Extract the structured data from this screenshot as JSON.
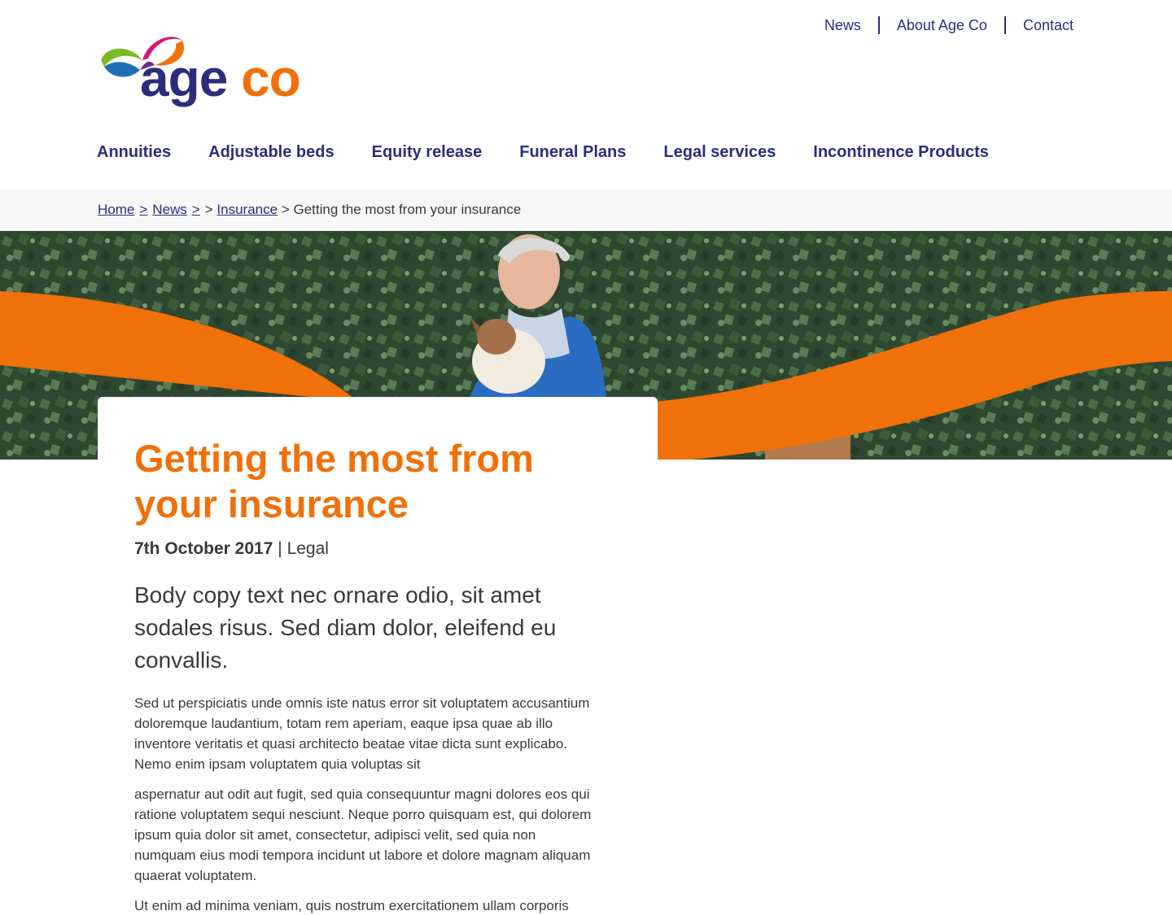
{
  "utility_nav": {
    "items": [
      {
        "label": "News"
      },
      {
        "label": "About Age Co"
      },
      {
        "label": "Contact"
      }
    ]
  },
  "logo": {
    "word1": "age",
    "word2": "co",
    "colors": {
      "navy": "#2b2d7c",
      "orange": "#f07009",
      "green": "#7ab929",
      "magenta": "#d6157a",
      "blue": "#1f6fb6"
    }
  },
  "main_nav": {
    "items": [
      {
        "label": "Annuities"
      },
      {
        "label": "Adjustable beds"
      },
      {
        "label": "Equity release"
      },
      {
        "label": "Funeral Plans"
      },
      {
        "label": "Legal services"
      },
      {
        "label": "Incontinence Products"
      }
    ]
  },
  "breadcrumb": {
    "home": "Home",
    "news": "News",
    "insurance": "Insurance",
    "current": "Getting the most from your insurance",
    "separator": ">"
  },
  "hero": {
    "image_icon": "hero-photo-woman-with-dog-icon"
  },
  "article": {
    "title": "Getting the most from your insurance",
    "date": "7th October 2017",
    "meta_separator": "|",
    "category": "Legal",
    "lead": "Body copy text nec ornare odio, sit amet sodales risus. Sed diam dolor, eleifend eu convallis.",
    "paragraphs": [
      "Sed ut perspiciatis unde omnis iste natus error sit voluptatem accusantium doloremque laudantium, totam rem aperiam, eaque ipsa quae ab illo inventore veritatis et quasi architecto beatae vitae dicta sunt explicabo. Nemo enim ipsam voluptatem quia voluptas sit",
      "aspernatur aut odit aut fugit, sed quia consequuntur magni dolores eos qui ratione voluptatem sequi nesciunt. Neque porro quisquam est, qui dolorem ipsum quia dolor sit amet, consectetur, adipisci velit, sed quia non numquam eius modi tempora incidunt ut labore et dolore magnam aliquam quaerat voluptatem.",
      "Ut enim ad minima veniam, quis nostrum exercitationem ullam corporis"
    ]
  },
  "colors": {
    "brand_navy": "#2b2d7c",
    "brand_orange": "#f07009",
    "breadcrumb_bg": "#f7f7f7",
    "text": "#3a3a3a"
  }
}
